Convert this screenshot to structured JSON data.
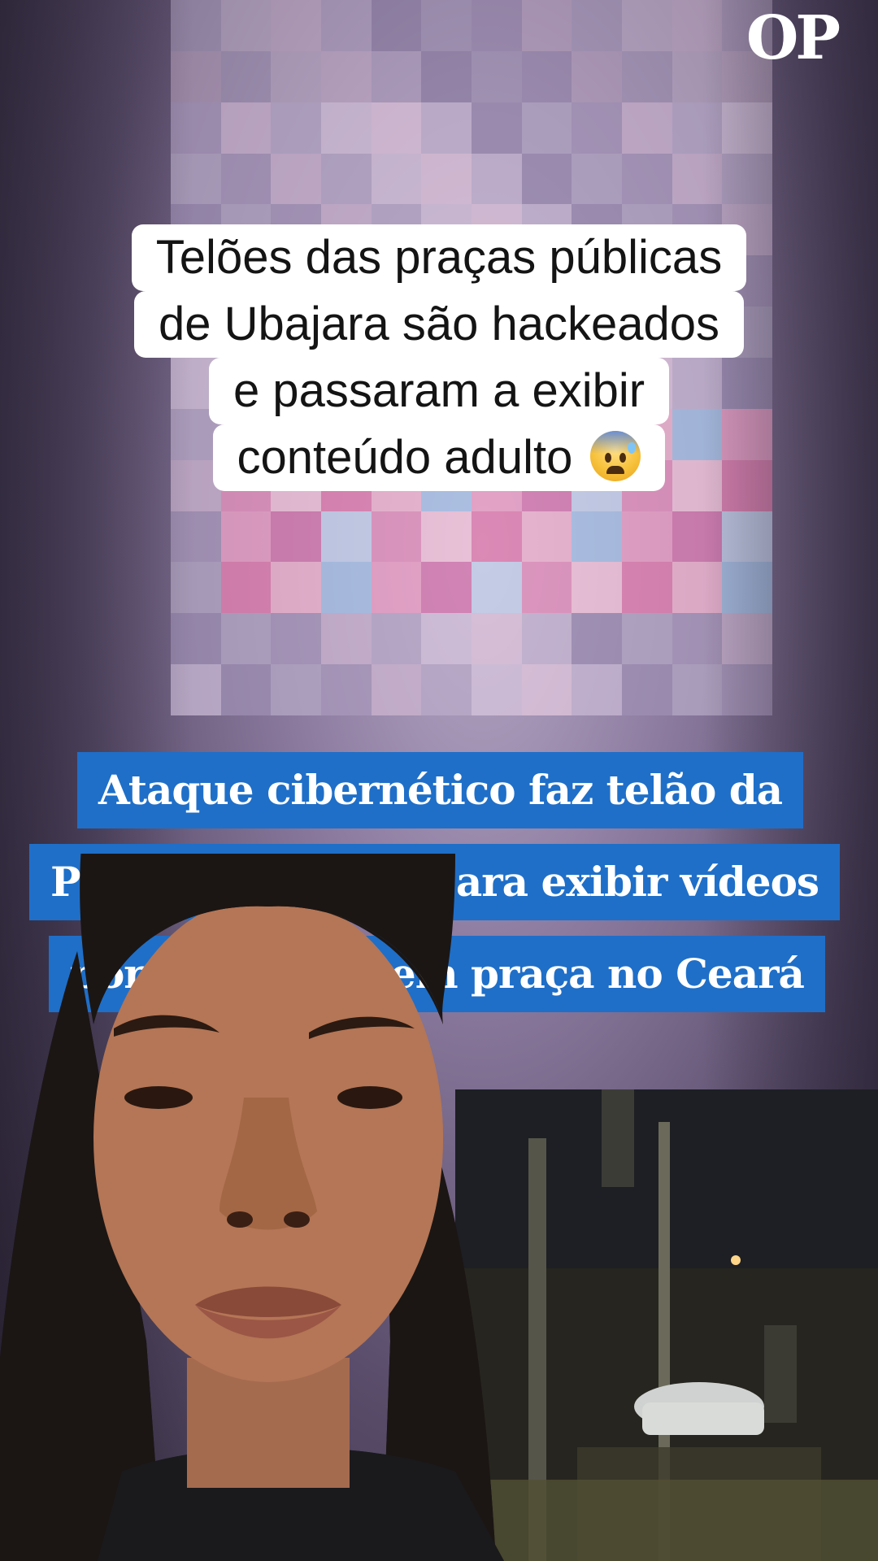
{
  "brand": {
    "logo_text": "OP"
  },
  "caption": {
    "lines": [
      "Telões das praças públicas",
      "de Ubajara são hackeados",
      "e passaram a exibir",
      "conteúdo adulto"
    ],
    "emoji": "anxious-face-with-sweat"
  },
  "headline": {
    "lines": [
      "Ataque cibernético faz telão da",
      "Prefeitura de Ubajara exibir vídeos",
      "pornográficos em praça no Ceará"
    ]
  },
  "colors": {
    "headline_bg": "#1f6fc8",
    "caption_bg": "#ffffff",
    "caption_text": "#141414"
  }
}
